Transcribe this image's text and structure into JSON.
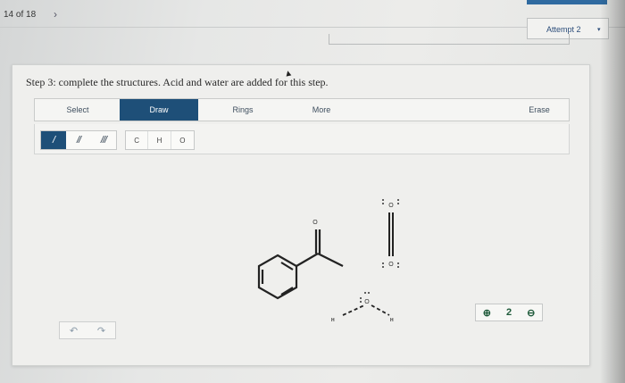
{
  "header": {
    "counter": "14 of 18",
    "next_glyph": "›",
    "attempt_label": "Attempt 2",
    "attempt_caret": "▾"
  },
  "step": {
    "title": "Step 3: complete the structures. Acid and water are added for this step."
  },
  "toolbar": {
    "tabs": [
      "Select",
      "Draw",
      "Rings",
      "More",
      "Erase"
    ],
    "active_tab": "Draw"
  },
  "bonds": {
    "single": "/",
    "double": "//",
    "triple": "///",
    "active": "single"
  },
  "atoms": [
    "C",
    "H",
    "O"
  ],
  "zoom": {
    "zoom_in_glyph": "⊕",
    "reset_glyph": "2",
    "zoom_out_glyph": "⊖"
  },
  "history": {
    "undo_glyph": "↶",
    "redo_glyph": "↷"
  },
  "molecules": {
    "aldehyde_label": "O",
    "water_h_left": "H",
    "water_o": "O",
    "water_h_right": "H",
    "co2_top_o": "O",
    "co2_bottom_o": "O"
  },
  "colors": {
    "accent": "#1e4f78",
    "card": "#efefed",
    "zoom_icon": "#1e5a3a"
  }
}
